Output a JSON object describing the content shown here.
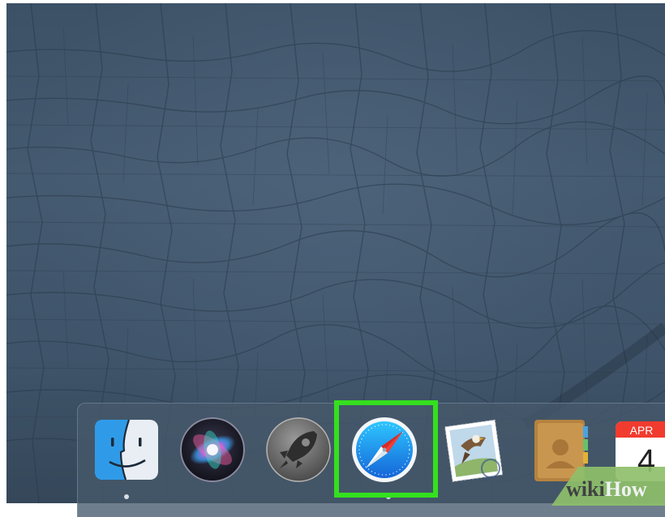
{
  "desktop": {
    "wallpaper": "cracked-earth-wallpaper",
    "accent_colors": {
      "highlight": "#34e01d",
      "wallpaper": "#42576c"
    }
  },
  "dock": {
    "apps": [
      {
        "id": "finder",
        "icon": "finder-icon",
        "running": true
      },
      {
        "id": "siri",
        "icon": "siri-icon",
        "running": false
      },
      {
        "id": "launchpad",
        "icon": "launchpad-rocket-icon",
        "running": false
      },
      {
        "id": "safari",
        "icon": "safari-compass-icon",
        "running": true,
        "highlighted": true
      },
      {
        "id": "mail",
        "icon": "mail-stamp-icon",
        "running": false
      },
      {
        "id": "contacts",
        "icon": "contacts-book-icon",
        "running": false
      },
      {
        "id": "calendar",
        "icon": "calendar-icon",
        "running": false,
        "month": "APR",
        "day": "4"
      }
    ]
  },
  "watermark": {
    "part1": "wiki",
    "part2": "How"
  }
}
